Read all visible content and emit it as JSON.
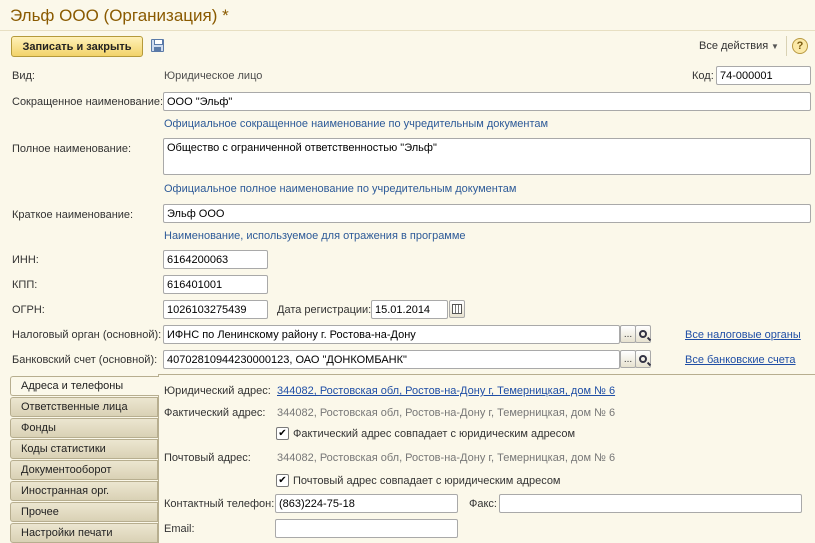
{
  "window": {
    "title": "Эльф ООО (Организация) *"
  },
  "toolbar": {
    "save_close_label": "Записать и закрыть",
    "all_actions_label": "Все действия",
    "help_label": "?"
  },
  "form": {
    "kind": {
      "label": "Вид:",
      "value": "Юридическое лицо"
    },
    "code": {
      "label": "Код:",
      "value": "74-000001"
    },
    "short_name": {
      "label": "Сокращенное наименование:",
      "value": "ООО \"Эльф\"",
      "hint": "Официальное сокращенное наименование по учредительным документам"
    },
    "full_name": {
      "label": "Полное наименование:",
      "value": "Общество с ограниченной ответственностью \"Эльф\"",
      "hint": "Официальное полное наименование по учредительным документам"
    },
    "brief_name": {
      "label": "Краткое наименование:",
      "value": "Эльф ООО",
      "hint": "Наименование, используемое для отражения в программе"
    },
    "inn": {
      "label": "ИНН:",
      "value": "6164200063"
    },
    "kpp": {
      "label": "КПП:",
      "value": "616401001"
    },
    "ogrn": {
      "label": "ОГРН:",
      "value": "1026103275439"
    },
    "reg_date": {
      "label": "Дата регистрации:",
      "value": "15.01.2014"
    },
    "tax_office": {
      "label": "Налоговый орган (основной):",
      "value": "ИФНС по Ленинскому району г. Ростова-на-Дону",
      "link": "Все налоговые органы"
    },
    "bank_account": {
      "label": "Банковский счет (основной):",
      "value": "40702810944230000123, ОАО \"ДОНКОМБАНК\"",
      "link": "Все банковские счета"
    },
    "ellipsis": "..."
  },
  "tabs": [
    {
      "label": "Адреса и телефоны",
      "active": true
    },
    {
      "label": "Ответственные лица",
      "active": false
    },
    {
      "label": "Фонды",
      "active": false
    },
    {
      "label": "Коды статистики",
      "active": false
    },
    {
      "label": "Документооборот",
      "active": false
    },
    {
      "label": "Иностранная орг.",
      "active": false
    },
    {
      "label": "Прочее",
      "active": false
    },
    {
      "label": "Настройки печати",
      "active": false
    }
  ],
  "addresses": {
    "legal": {
      "label": "Юридический адрес:",
      "value": "344082, Ростовская обл, Ростов-на-Дону г, Темерницкая, дом № 6"
    },
    "actual": {
      "label": "Фактический адрес:",
      "value": "344082, Ростовская обл, Ростов-на-Дону г, Темерницкая, дом № 6"
    },
    "actual_same": {
      "label": "Фактический адрес совпадает с юридическим адресом",
      "checked": true
    },
    "postal": {
      "label": "Почтовый адрес:",
      "value": "344082, Ростовская обл, Ростов-на-Дону г, Темерницкая, дом № 6"
    },
    "postal_same": {
      "label": "Почтовый адрес совпадает с юридическим адресом",
      "checked": true
    },
    "phone": {
      "label": "Контактный телефон:",
      "value": "(863)224-75-18"
    },
    "fax": {
      "label": "Факс:",
      "value": ""
    },
    "email": {
      "label": "Email:",
      "value": ""
    },
    "check_mark": "✔"
  },
  "colors": {
    "background": "#fbf8ea",
    "title": "#8a5a00",
    "hint": "#2d5a98",
    "link": "#1f4ea5"
  }
}
